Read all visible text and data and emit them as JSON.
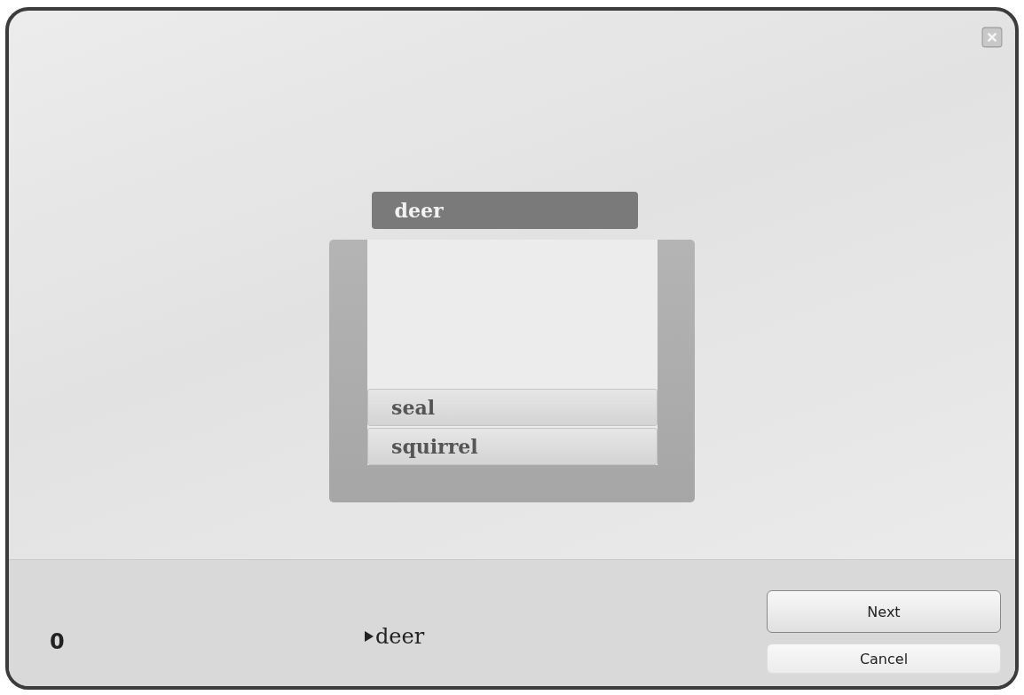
{
  "current_word": "deer",
  "stack": [
    {
      "label": "seal"
    },
    {
      "label": "squirrel"
    }
  ],
  "score": "0",
  "audio": {
    "label": "deer"
  },
  "buttons": [
    {
      "label": "Next"
    },
    {
      "label": "Cancel"
    }
  ]
}
